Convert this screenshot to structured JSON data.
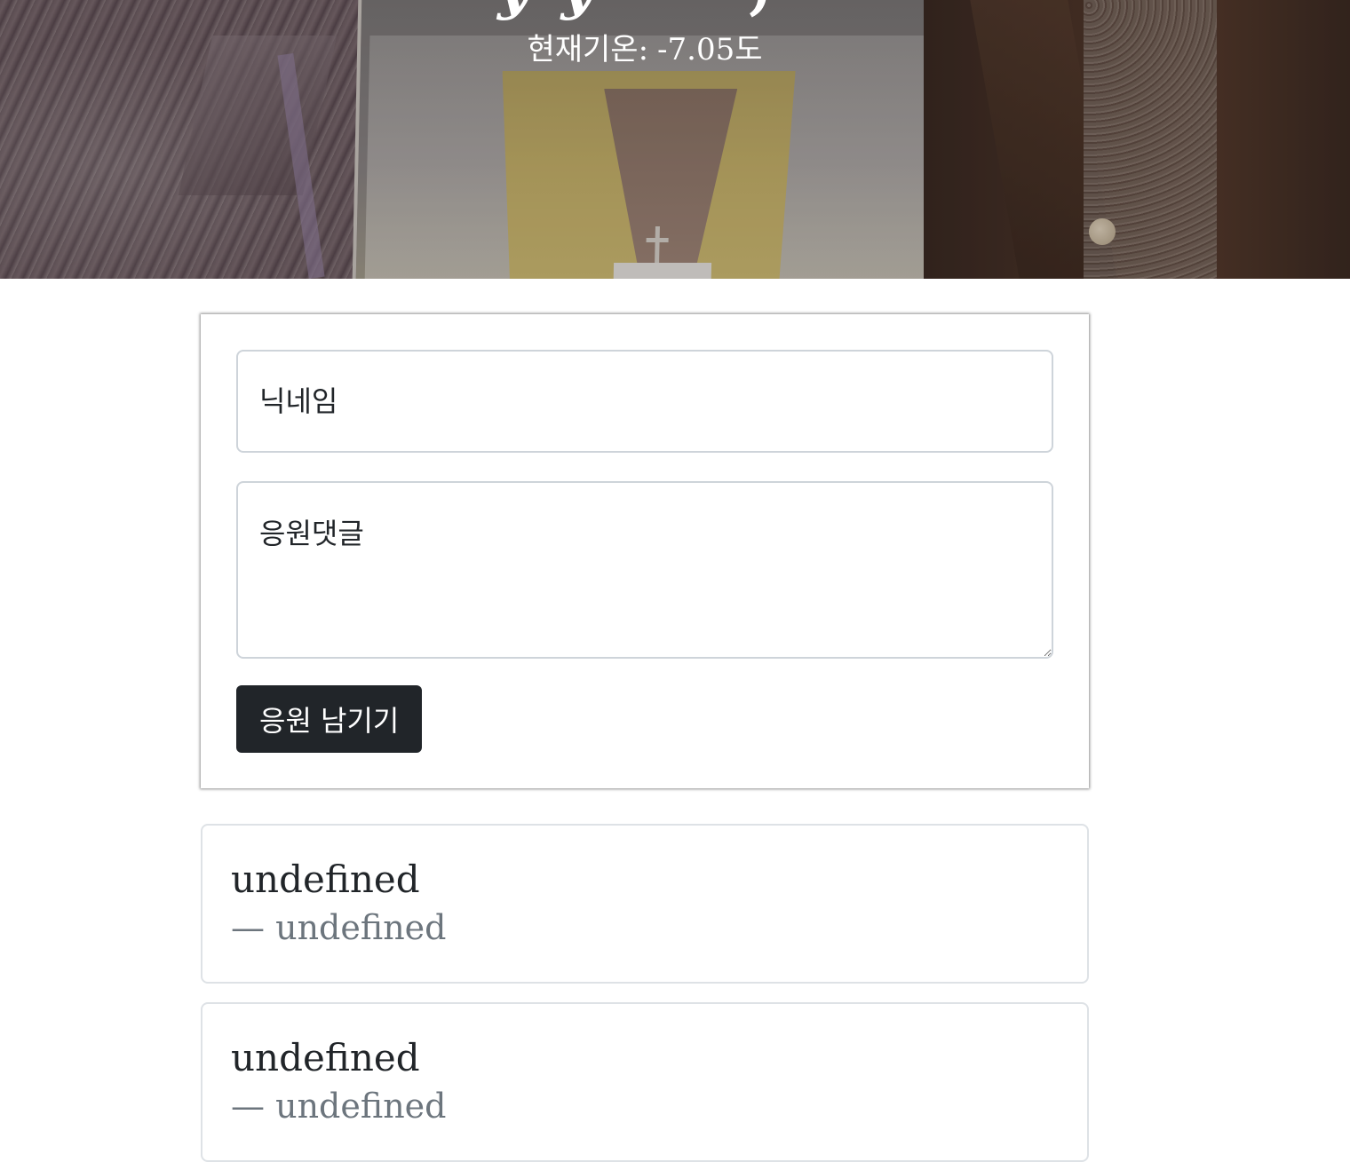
{
  "header": {
    "temperature_label": "현재기온:",
    "temperature_value": "-7.05도"
  },
  "form": {
    "nickname_placeholder": "닉네임",
    "comment_placeholder": "응원댓글",
    "submit_label": "응원 남기기"
  },
  "comments": [
    {
      "text": "undefined",
      "author_prefix": "—",
      "author": "undefined"
    },
    {
      "text": "undefined",
      "author_prefix": "—",
      "author": "undefined"
    }
  ],
  "colors": {
    "button_bg": "#212529",
    "muted_text": "#6c757d",
    "card_border": "#dee2e6"
  }
}
